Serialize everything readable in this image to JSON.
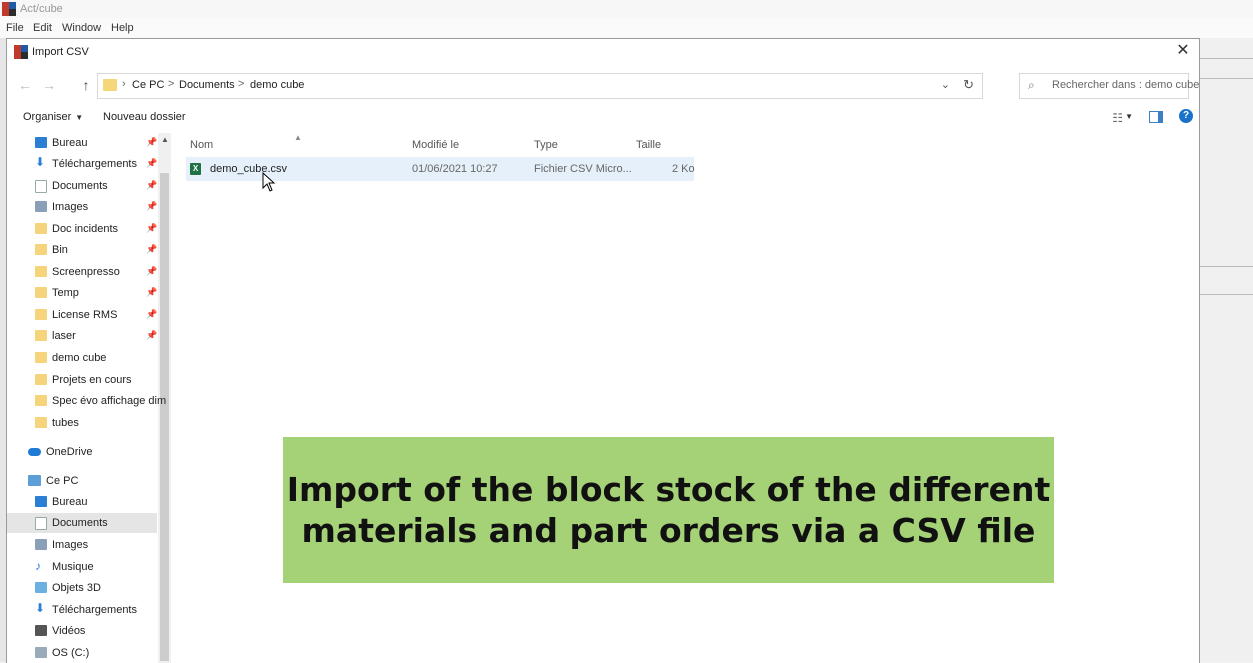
{
  "app": {
    "title": "Act/cube",
    "menu": [
      "File",
      "Edit",
      "Window",
      "Help"
    ]
  },
  "dialog": {
    "title": "Import CSV",
    "close_glyph": "✕",
    "nav": {
      "back_glyph": "←",
      "forward_glyph": "→",
      "up_glyph": "↑"
    },
    "address": {
      "crumbs": [
        "Ce PC",
        "Documents",
        "demo cube"
      ],
      "sep_glyph": ">",
      "chevron_first": "›"
    },
    "search": {
      "placeholder": "Rechercher dans : demo cube"
    },
    "toolbar": {
      "organize": "Organiser",
      "new_folder": "Nouveau dossier",
      "help": "?"
    },
    "columns": {
      "name": "Nom",
      "modified": "Modifié le",
      "type": "Type",
      "size": "Taille"
    },
    "files": [
      {
        "name": "demo_cube.csv",
        "modified": "01/06/2021 10:27",
        "type": "Fichier CSV Micro...",
        "size": "2 Ko"
      }
    ],
    "sidebar": {
      "quick": [
        {
          "label": "Bureau",
          "icon": "desktop-icon",
          "pinned": true
        },
        {
          "label": "Téléchargements",
          "icon": "downloads-icon",
          "pinned": true
        },
        {
          "label": "Documents",
          "icon": "documents-icon",
          "pinned": true
        },
        {
          "label": "Images",
          "icon": "images-icon",
          "pinned": true
        },
        {
          "label": "Doc incidents",
          "icon": "folder-icon",
          "pinned": true
        },
        {
          "label": "Bin",
          "icon": "folder-icon",
          "pinned": true
        },
        {
          "label": "Screenpresso",
          "icon": "folder-icon",
          "pinned": true
        },
        {
          "label": "Temp",
          "icon": "folder-icon",
          "pinned": true
        },
        {
          "label": "License RMS",
          "icon": "folder-icon",
          "pinned": true
        },
        {
          "label": "laser",
          "icon": "folder-icon",
          "pinned": true
        },
        {
          "label": "demo cube",
          "icon": "folder-icon",
          "pinned": false
        },
        {
          "label": "Projets en cours",
          "icon": "folder-icon",
          "pinned": false
        },
        {
          "label": "Spec évo affichage dim",
          "icon": "folder-icon",
          "pinned": false
        },
        {
          "label": "tubes",
          "icon": "folder-icon",
          "pinned": false
        }
      ],
      "onedrive": "OneDrive",
      "this_pc": "Ce PC",
      "pc_items": [
        {
          "label": "Bureau",
          "icon": "desktop-icon",
          "selected": false
        },
        {
          "label": "Documents",
          "icon": "documents-icon",
          "selected": true
        },
        {
          "label": "Images",
          "icon": "images-icon",
          "selected": false
        },
        {
          "label": "Musique",
          "icon": "music-icon",
          "selected": false
        },
        {
          "label": "Objets 3D",
          "icon": "3d-objects-icon",
          "selected": false
        },
        {
          "label": "Téléchargements",
          "icon": "downloads-icon",
          "selected": false
        },
        {
          "label": "Vidéos",
          "icon": "videos-icon",
          "selected": false
        },
        {
          "label": "OS (C:)",
          "icon": "drive-icon",
          "selected": false
        }
      ]
    }
  },
  "caption": {
    "line1": "Import of the block stock of the different",
    "line2": "materials and part orders via a CSV file"
  },
  "colors": {
    "caption_bg": "#a6d277",
    "accent": "#1a73c8",
    "selection": "#e6f0fb"
  }
}
